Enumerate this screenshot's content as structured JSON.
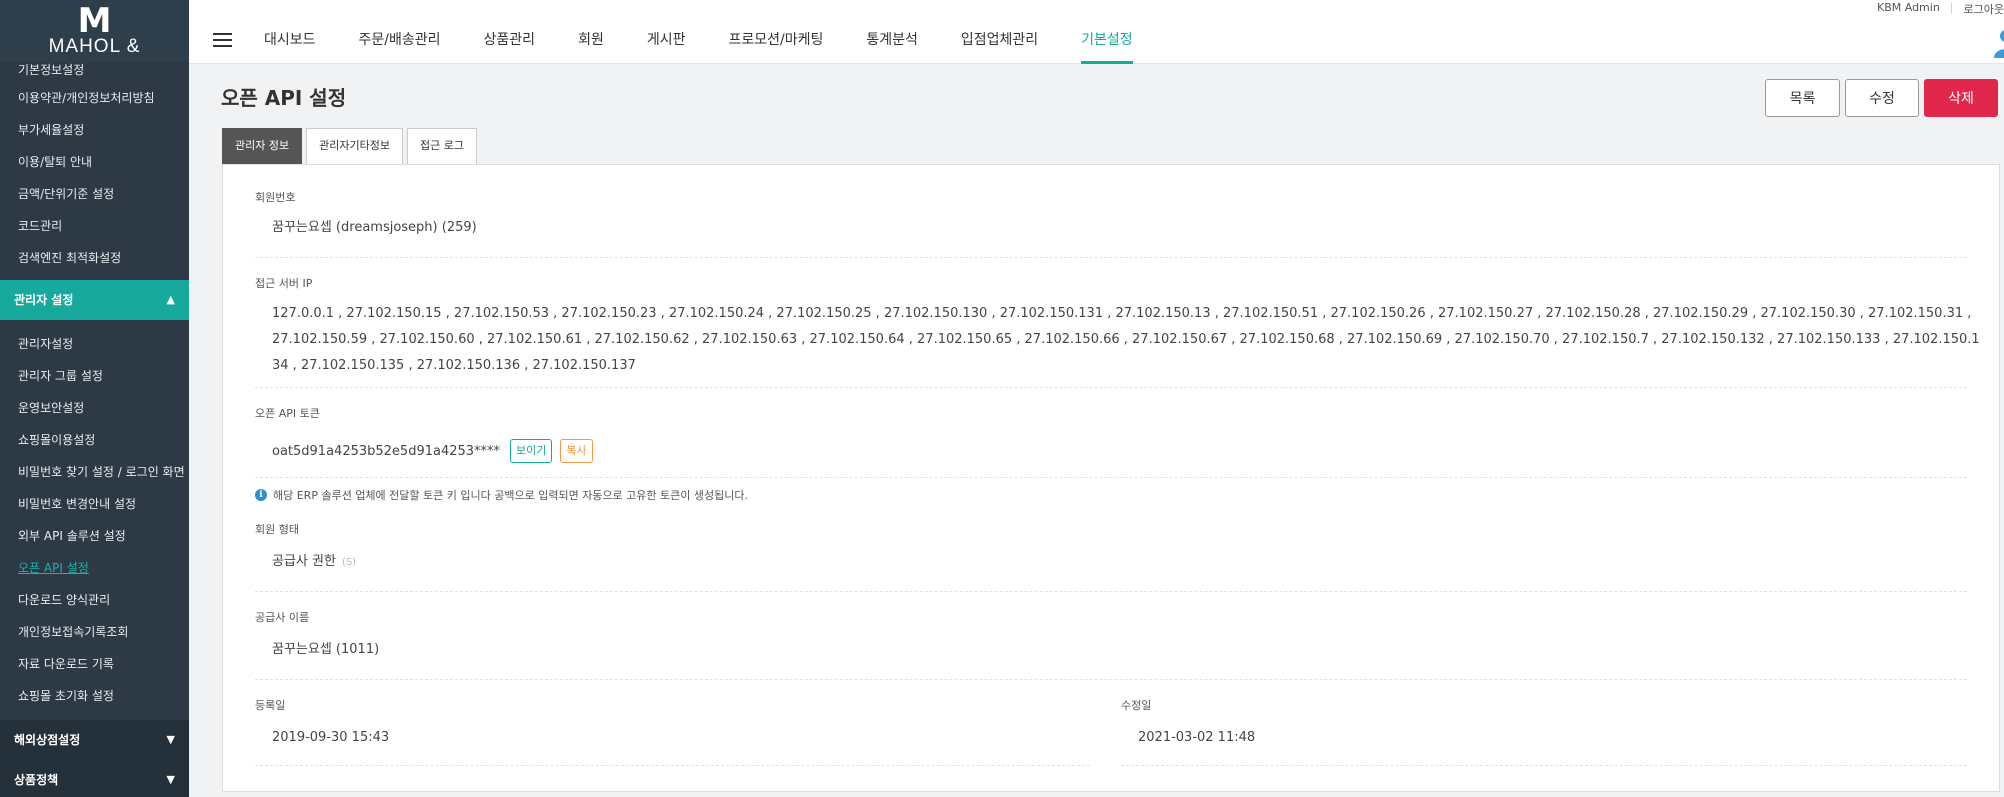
{
  "brand": {
    "logo_mark": "M",
    "logo_text": "MAHOL &"
  },
  "top_util": {
    "user": "KBM Admin",
    "logout": "로그아웃"
  },
  "nav": [
    {
      "label": "대시보드"
    },
    {
      "label": "주문/배송관리"
    },
    {
      "label": "상품관리"
    },
    {
      "label": "회원"
    },
    {
      "label": "게시판"
    },
    {
      "label": "프로모션/마케팅"
    },
    {
      "label": "통계분석"
    },
    {
      "label": "입점업체관리"
    },
    {
      "label": "기본설정",
      "active": true
    }
  ],
  "sidebar": {
    "items_top": [
      "기본정보설정",
      "이용약관/개인정보처리방침",
      "부가세율설정",
      "이용/탈퇴 안내",
      "금액/단위기준 설정",
      "코드관리",
      "검색엔진 최적화설정"
    ],
    "group_open": "관리자 설정",
    "items_admin": [
      "관리자설정",
      "관리자 그룹 설정",
      "운영보안설정",
      "쇼핑몰이용설정",
      "비밀번호 찾기 설정 / 로그인 화면",
      "비밀번호 변경안내 설정",
      "외부 API 솔루션 설정",
      "오픈 API 설정",
      "다운로드 양식관리",
      "개인정보접속기록조회",
      "자료 다운로드 기록",
      "쇼핑몰 초기화 설정"
    ],
    "active_item": "오픈 API 설정",
    "group_overseas": "해외상점설정",
    "group_product": "상품정책"
  },
  "page": {
    "title": "오픈 API 설정",
    "btn_list": "목록",
    "btn_edit": "수정",
    "btn_delete": "삭제"
  },
  "tabs": [
    {
      "label": "관리자 정보",
      "active": true
    },
    {
      "label": "관리자기타정보"
    },
    {
      "label": "접근 로그"
    }
  ],
  "fields": {
    "member_no_label": "회원번호",
    "member_no_value": "꿈꾸는요셉 (dreamsjoseph) (259)",
    "ip_label": "접근 서버 IP",
    "ip_value": "127.0.0.1  , 27.102.150.15  , 27.102.150.53  , 27.102.150.23  , 27.102.150.24  , 27.102.150.25  , 27.102.150.130  , 27.102.150.131  , 27.102.150.13  , 27.102.150.51  , 27.102.150.26  , 27.102.150.27  , 27.102.150.28  , 27.102.150.29  , 27.102.150.30  , 27.102.150.31  , 27.102.150.59  , 27.102.150.60  , 27.102.150.61  , 27.102.150.62  , 27.102.150.63  , 27.102.150.64  , 27.102.150.65  , 27.102.150.66  , 27.102.150.67  , 27.102.150.68  , 27.102.150.69  , 27.102.150.70  , 27.102.150.7  , 27.102.150.132  , 27.102.150.133  , 27.102.150.134  , 27.102.150.135  , 27.102.150.136  , 27.102.150.137",
    "token_label": "오픈 API 토큰",
    "token_value": "oat5d91a4253b52e5d91a4253****",
    "token_show": "보이기",
    "token_copy": "복사",
    "notice": "해당 ERP 솔루션 업체에 전달할 토큰 키 입니다 공백으로 입력되면 자동으로 고유한 토큰이 생성됩니다.",
    "member_type_label": "회원 형태",
    "member_type_value": "공급사 권한",
    "member_type_sub": "(S)",
    "supplier_label": "공급사 이름",
    "supplier_value": "꿈꾸는요셉 (1011)",
    "reg_date_label": "등록일",
    "reg_date_value": "2019-09-30 15:43",
    "mod_date_label": "수정일",
    "mod_date_value": "2021-03-02 11:48"
  },
  "colors": {
    "accent": "#17aa9c",
    "danger": "#e1264b",
    "sidebar": "#2d3a46",
    "copy": "#f29a45"
  }
}
